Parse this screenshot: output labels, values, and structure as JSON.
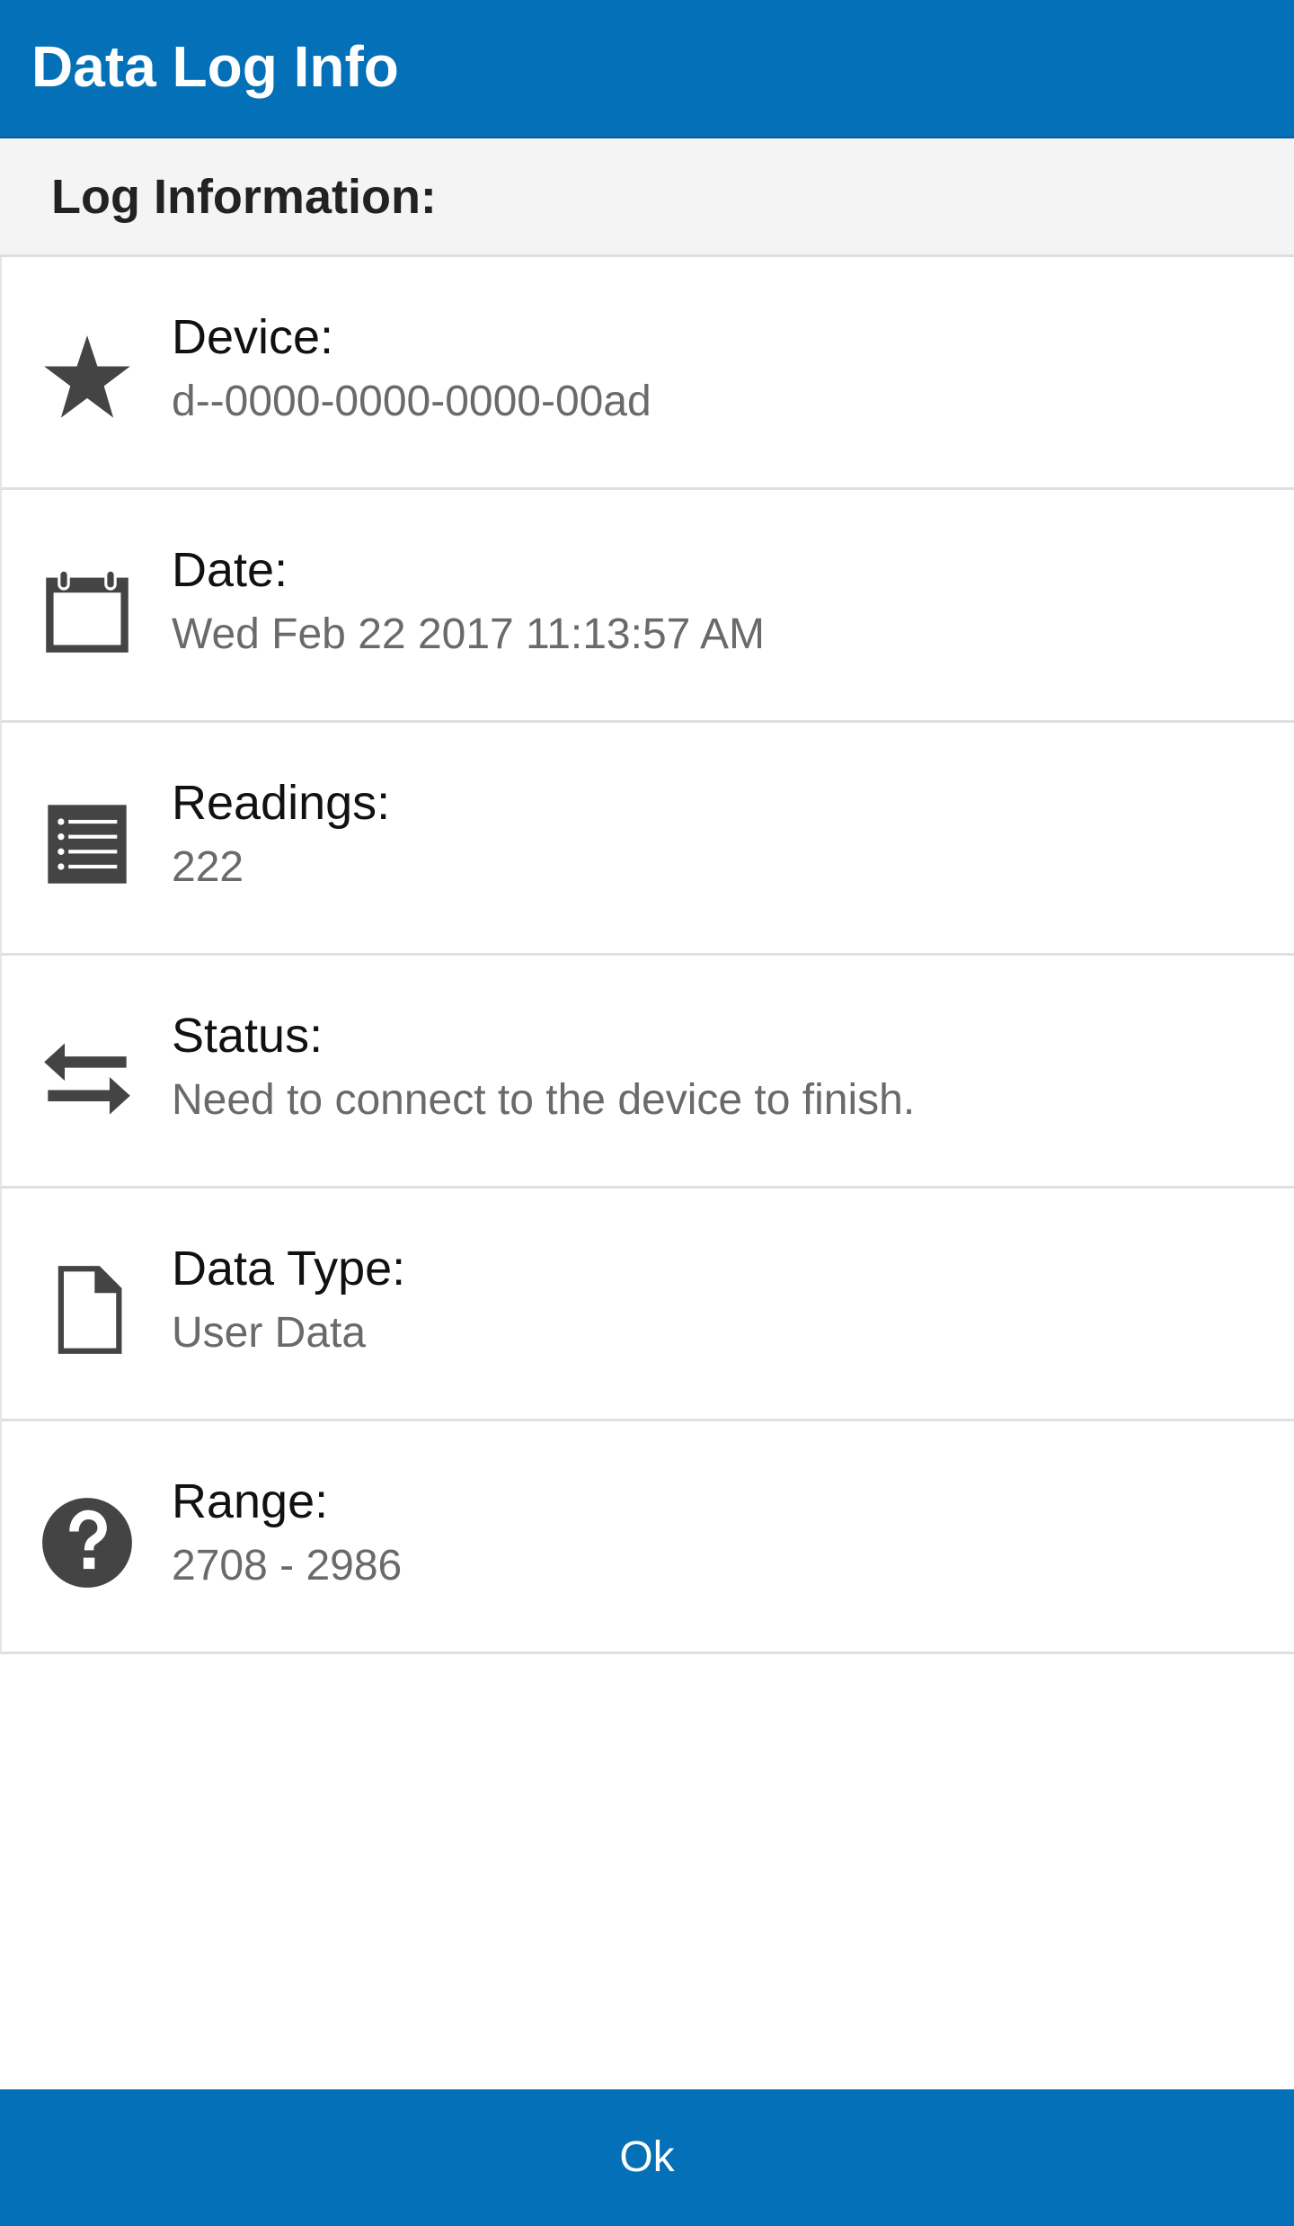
{
  "app": {
    "title": "Data Log Info"
  },
  "section": {
    "title": "Log Information:"
  },
  "rows": [
    {
      "icon": "star-icon",
      "label": "Device:",
      "value": "d--0000-0000-0000-00ad"
    },
    {
      "icon": "calendar-icon",
      "label": "Date:",
      "value": "Wed Feb 22 2017 11:13:57 AM"
    },
    {
      "icon": "list-icon",
      "label": "Readings:",
      "value": "222"
    },
    {
      "icon": "transfer-arrows-icon",
      "label": "Status:",
      "value": "Need to connect to the device to finish."
    },
    {
      "icon": "file-icon",
      "label": "Data Type:",
      "value": "User Data"
    },
    {
      "icon": "question-circle-icon",
      "label": "Range:",
      "value": "2708 - 2986"
    }
  ],
  "footer": {
    "ok_label": "Ok"
  },
  "colors": {
    "brand": "#0370b7",
    "header_bg": "#f4f4f4",
    "icon": "#444444",
    "value_text": "#6a6a6a"
  }
}
